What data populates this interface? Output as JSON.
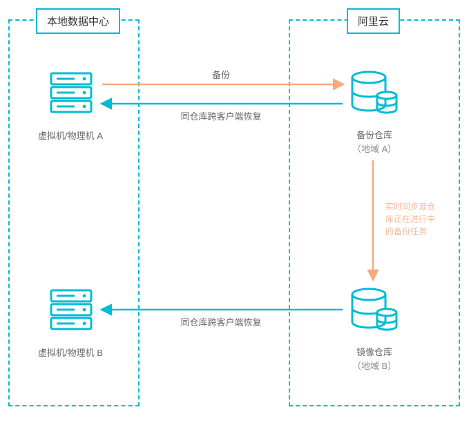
{
  "diagram": {
    "regions": {
      "local": {
        "title": "本地数据中心"
      },
      "cloud": {
        "title": "阿里云"
      }
    },
    "nodes": {
      "vmA": {
        "label": "虚拟机/物理机 A"
      },
      "vmB": {
        "label": "虚拟机/物理机 B"
      },
      "vaultA": {
        "label_l1": "备份仓库",
        "label_l2": "（地域 A）"
      },
      "vaultB": {
        "label_l1": "镜像仓库",
        "label_l2": "（地域 B）"
      }
    },
    "edges": {
      "backup": {
        "label": "备份"
      },
      "restoreA": {
        "label": "同仓库跨客户端恢复"
      },
      "restoreB": {
        "label": "同仓库跨客户端恢复"
      },
      "sync": {
        "label_l1": "实时同步源仓",
        "label_l2": "库正在进行中",
        "label_l3": "的备份任务"
      }
    },
    "colors": {
      "teal": "#00bcd4",
      "orange": "#f8a97f",
      "light_orange": "#f5b99a",
      "text": "#666666"
    }
  }
}
